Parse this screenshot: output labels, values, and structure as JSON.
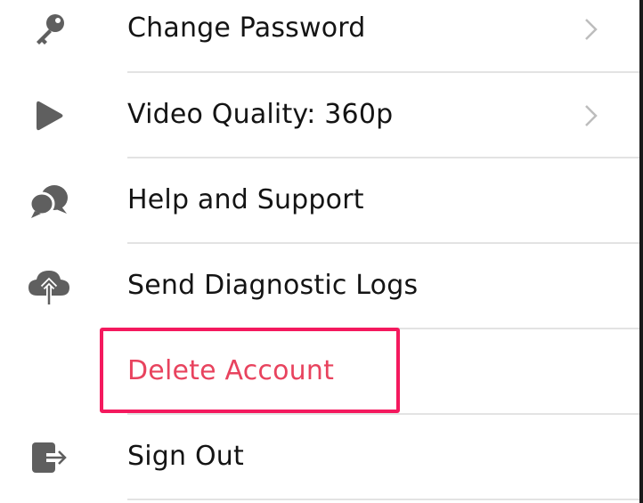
{
  "menu": {
    "items": [
      {
        "label": "Change Password",
        "icon": "key-icon",
        "has_chevron": true
      },
      {
        "label": "Video Quality: 360p",
        "icon": "play-icon",
        "has_chevron": true
      },
      {
        "label": "Help and Support",
        "icon": "chat-bubbles-icon",
        "has_chevron": false
      },
      {
        "label": "Send Diagnostic Logs",
        "icon": "cloud-upload-icon",
        "has_chevron": false
      },
      {
        "label": "Delete Account",
        "icon": "",
        "has_chevron": false
      },
      {
        "label": "Sign Out",
        "icon": "sign-out-icon",
        "has_chevron": false
      }
    ]
  },
  "colors": {
    "text": "#141414",
    "danger_text": "#e8435e",
    "icon": "#5f5f5f",
    "chevron": "#bdbdbd",
    "divider": "#e3e3e3",
    "highlight": "#f4195e"
  }
}
